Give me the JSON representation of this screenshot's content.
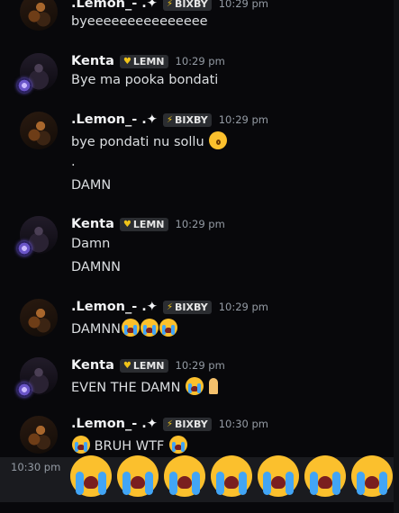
{
  "tags": {
    "bixby": "BIXBY",
    "lemn": "LEMN"
  },
  "users": {
    "lemon": ".Lemon_- .✦",
    "kenta": "Kenta"
  },
  "messages": [
    {
      "author": ".Lemon_- .✦",
      "time": "10:29 pm",
      "lines": [
        "byeeeeeeeeeeeeeee"
      ]
    },
    {
      "author": "Kenta",
      "time": "10:29 pm",
      "lines": [
        "Bye ma pooka bondati"
      ]
    },
    {
      "author": ".Lemon_- .✦",
      "time": "10:29 pm",
      "lines": [
        "bye pondati nu sollu",
        ".",
        "DAMN"
      ]
    },
    {
      "author": "Kenta",
      "time": "10:29 pm",
      "lines": [
        "Damn",
        "DAMNN"
      ]
    },
    {
      "author": ".Lemon_- .✦",
      "time": "10:29 pm",
      "lines": [
        "DAMNN"
      ]
    },
    {
      "author": "Kenta",
      "time": "10:29 pm",
      "lines": [
        "EVEN THE DAMN"
      ]
    },
    {
      "author": ".Lemon_- .✦",
      "time": "10:30 pm",
      "lines": [
        "BRUH WTF"
      ]
    }
  ],
  "hover": {
    "time": "10:30 pm"
  },
  "icons": {
    "emoji_cry": "loudly-crying-face",
    "emoji_kiss": "kissing-face",
    "emoji_pray": "folded-hands"
  }
}
